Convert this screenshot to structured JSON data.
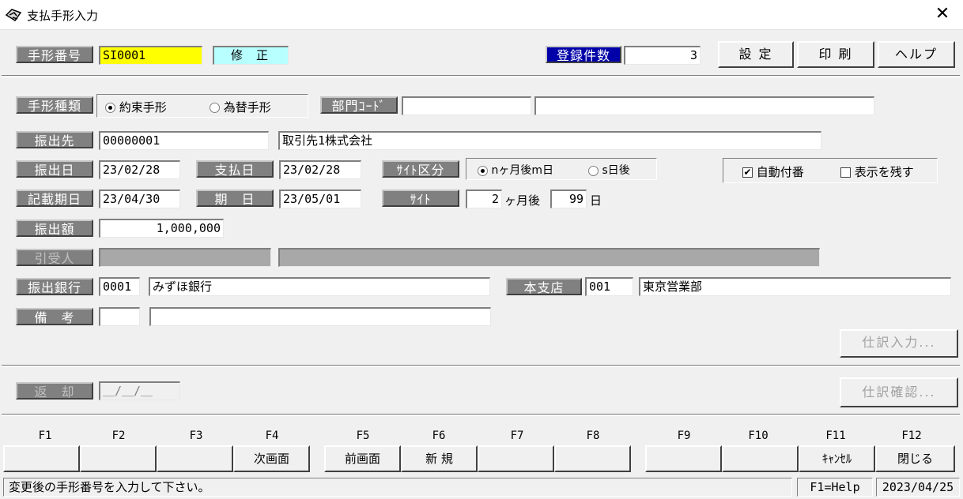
{
  "window": {
    "title": "支払手形入力",
    "close_glyph": "✕"
  },
  "header": {
    "note_no_label": "手形番号",
    "note_no_value": "SI0001",
    "mode": "修 正",
    "count_label": "登録件数",
    "count_value": "3",
    "buttons": {
      "settings": "設 定",
      "print": "印 刷",
      "help": "ヘルプ"
    }
  },
  "form": {
    "note_type_label": "手形種類",
    "note_type_options": [
      "約束手形",
      "為替手形"
    ],
    "note_type_selected": "約束手形",
    "dept_label": "部門ｺｰﾄﾞ",
    "dept_code": "",
    "dept_name": "",
    "payee_label": "振出先",
    "payee_code": "00000001",
    "payee_name": "取引先1株式会社",
    "issue_date_label": "振出日",
    "issue_date": "23/02/28",
    "pay_date_label": "支払日",
    "pay_date": "23/02/28",
    "site_kind_label": "ｻｲﾄ区分",
    "site_kind_options": [
      "nヶ月後m日",
      "s日後"
    ],
    "site_kind_selected": "nヶ月後m日",
    "auto_number_label": "自動付番",
    "auto_number_checked": true,
    "keep_display_label": "表示を残す",
    "keep_display_checked": false,
    "record_date_label": "記載期日",
    "record_date": "23/04/30",
    "due_label": "期　日",
    "due_date": "23/05/01",
    "site_label": "ｻｲﾄ",
    "site_months": "2",
    "site_months_unit": "ヶ月後",
    "site_days": "99",
    "site_days_unit": "日",
    "amount_label": "振出額",
    "amount": "1,000,000",
    "acceptor_label": "引受人",
    "bank_label": "振出銀行",
    "bank_code": "0001",
    "bank_name": "みずほ銀行",
    "branch_label": "本支店",
    "branch_code": "001",
    "branch_name": "東京営業部",
    "remarks_label": "備　考",
    "journal_input_button": "仕訳入力...",
    "return_label": "返　却",
    "return_date": "＿/＿/＿",
    "journal_confirm_button": "仕訳確認..."
  },
  "fkeys": [
    {
      "key": "F1",
      "label": ""
    },
    {
      "key": "F2",
      "label": ""
    },
    {
      "key": "F3",
      "label": ""
    },
    {
      "key": "F4",
      "label": "次画面"
    },
    {
      "key": "F5",
      "label": "前画面"
    },
    {
      "key": "F6",
      "label": "新 規"
    },
    {
      "key": "F7",
      "label": ""
    },
    {
      "key": "F8",
      "label": ""
    },
    {
      "key": "F9",
      "label": ""
    },
    {
      "key": "F10",
      "label": ""
    },
    {
      "key": "F11",
      "label": "ｷｬﾝｾﾙ"
    },
    {
      "key": "F12",
      "label": "閉じる"
    }
  ],
  "statusbar": {
    "message": "変更後の手形番号を入力して下さい。",
    "help": "F1=Help",
    "date": "2023/04/25"
  }
}
